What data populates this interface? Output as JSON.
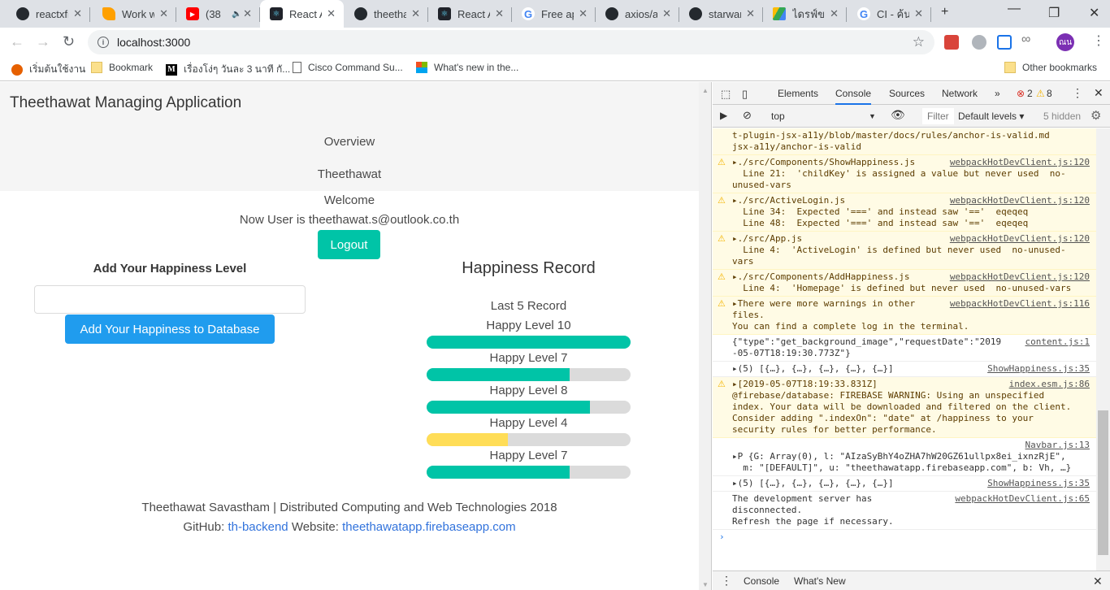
{
  "browser": {
    "tabs": [
      {
        "title": "reactxfi",
        "icon": "github-icon",
        "color": "#24292e",
        "active": false
      },
      {
        "title": "Work w",
        "icon": "firebase-icon",
        "color": "#ffa000",
        "active": false
      },
      {
        "title": "(38",
        "icon": "youtube-icon",
        "color": "#ff0000",
        "active": false,
        "audio": "🔊"
      },
      {
        "title": "React A",
        "icon": "react-icon",
        "color": "#20232a",
        "active": true
      },
      {
        "title": "theetha",
        "icon": "github-icon",
        "color": "#24292e",
        "active": false
      },
      {
        "title": "React A",
        "icon": "react-icon",
        "color": "#20232a",
        "active": false
      },
      {
        "title": "Free ap",
        "icon": "google-icon",
        "color": "#4285f4",
        "active": false
      },
      {
        "title": "axios/a",
        "icon": "github-icon",
        "color": "#24292e",
        "active": false
      },
      {
        "title": "starwar",
        "icon": "github-icon",
        "color": "#24292e",
        "active": false
      },
      {
        "title": "ไดรฟ์ของ",
        "icon": "google-drive-icon",
        "color": "#34a853",
        "active": false
      },
      {
        "title": "CI - ค้นห",
        "icon": "google-icon",
        "color": "#4285f4",
        "active": false
      }
    ],
    "new_tab": "+",
    "url": "localhost:3000",
    "profile_initials": "ณน",
    "bookmarks": [
      {
        "label": "เริ่มต้นใช้งาน",
        "icon": "firefox-icon"
      },
      {
        "label": "Bookmark",
        "icon": "folder-icon"
      },
      {
        "label": "เรื่องโง่ๆ วันละ 3 นาที กั...",
        "icon": "medium-icon"
      },
      {
        "label": "Cisco Command Su...",
        "icon": "page-icon"
      },
      {
        "label": "What's new in the...",
        "icon": "windows-icon"
      }
    ],
    "other_bookmarks": "Other bookmarks"
  },
  "app": {
    "brand": "Theethawat Managing Application",
    "nav": [
      "Overview",
      "Theethawat"
    ],
    "welcome": "Welcome",
    "user_line": "Now User is theethawat.s@outlook.co.th",
    "logout": "Logout",
    "add_title": "Add Your Happiness Level",
    "input_value": "",
    "add_button": "Add Your Happiness to Database",
    "record_title": "Happiness Record",
    "last_records": "Last 5 Record",
    "records": [
      {
        "label": "Happy Level 10",
        "level": 10,
        "max": 10,
        "color": "#00c4a7"
      },
      {
        "label": "Happy Level 7",
        "level": 7,
        "max": 10,
        "color": "#00c4a7"
      },
      {
        "label": "Happy Level 8",
        "level": 8,
        "max": 10,
        "color": "#00c4a7"
      },
      {
        "label": "Happy Level 4",
        "level": 4,
        "max": 10,
        "color": "#ffdd57"
      },
      {
        "label": "Happy Level 7",
        "level": 7,
        "max": 10,
        "color": "#00c4a7"
      }
    ],
    "footer_line": "Theethawat Savastham | Distributed Computing and Web Technologies 2018",
    "github_label": "GitHub:",
    "github_link": "th-backend",
    "website_label": "Website:",
    "website_link": "theethawatapp.firebaseapp.com"
  },
  "devtools": {
    "tabs": [
      "Elements",
      "Console",
      "Sources",
      "Network"
    ],
    "active_tab": "Console",
    "more": "»",
    "error_count": "2",
    "warning_count": "8",
    "context": "top",
    "filter_placeholder": "Filter",
    "levels": "Default levels ▾",
    "hidden": "5 hidden",
    "messages": [
      {
        "type": "warn-cont",
        "text": "t-plugin-jsx-a11y/blob/master/docs/rules/anchor-is-valid.md\njsx-a11y/anchor-is-valid",
        "source": ""
      },
      {
        "type": "warn",
        "text": "▸./src/Components/ShowHappiness.js\n  Line 21:  'childKey' is assigned a value but never used  no-\nunused-vars",
        "source": "webpackHotDevClient.js:120"
      },
      {
        "type": "warn",
        "text": "▸./src/ActiveLogin.js\n  Line 34:  Expected '===' and instead saw '=='  eqeqeq\n  Line 48:  Expected '===' and instead saw '=='  eqeqeq",
        "source": "webpackHotDevClient.js:120"
      },
      {
        "type": "warn",
        "text": "▸./src/App.js\n  Line 4:  'ActiveLogin' is defined but never used  no-unused-\nvars",
        "source": "webpackHotDevClient.js:120"
      },
      {
        "type": "warn",
        "text": "▸./src/Components/AddHappiness.js\n  Line 4:  'Homepage' is defined but never used  no-unused-vars",
        "source": "webpackHotDevClient.js:120"
      },
      {
        "type": "warn",
        "text": "▸There were more warnings in other\nfiles.\nYou can find a complete log in the terminal.",
        "source": "webpackHotDevClient.js:116"
      },
      {
        "type": "log",
        "text": "{\"type\":\"get_background_image\",\"requestDate\":\"2019\n-05-07T18:19:30.773Z\"}",
        "source": "content.js:1"
      },
      {
        "type": "log",
        "text": "▸(5) [{…}, {…}, {…}, {…}, {…}]",
        "source": "ShowHappiness.js:35"
      },
      {
        "type": "warn",
        "text": "▸[2019-05-07T18:19:33.831Z]\n@firebase/database: FIREBASE WARNING: Using an unspecified\nindex. Your data will be downloaded and filtered on the client.\nConsider adding \".indexOn\": \"date\" at /happiness to your\nsecurity rules for better performance.",
        "source": "index.esm.js:86"
      },
      {
        "type": "log",
        "text": "\n▸P {G: Array(0), l: \"AIzaSyBhY4oZHA7hW20GZ61ullpx8ei_ixnzRjE\",\n  m: \"[DEFAULT]\", u: \"theethawatapp.firebaseapp.com\", b: Vh, …}",
        "source": "Navbar.js:13"
      },
      {
        "type": "log",
        "text": "▸(5) [{…}, {…}, {…}, {…}, {…}]",
        "source": "ShowHappiness.js:35"
      },
      {
        "type": "log",
        "text": "The development server has\ndisconnected.\nRefresh the page if necessary.",
        "source": "webpackHotDevClient.js:65"
      }
    ],
    "prompt": "›",
    "drawer_tabs": [
      "Console",
      "What's New"
    ]
  }
}
